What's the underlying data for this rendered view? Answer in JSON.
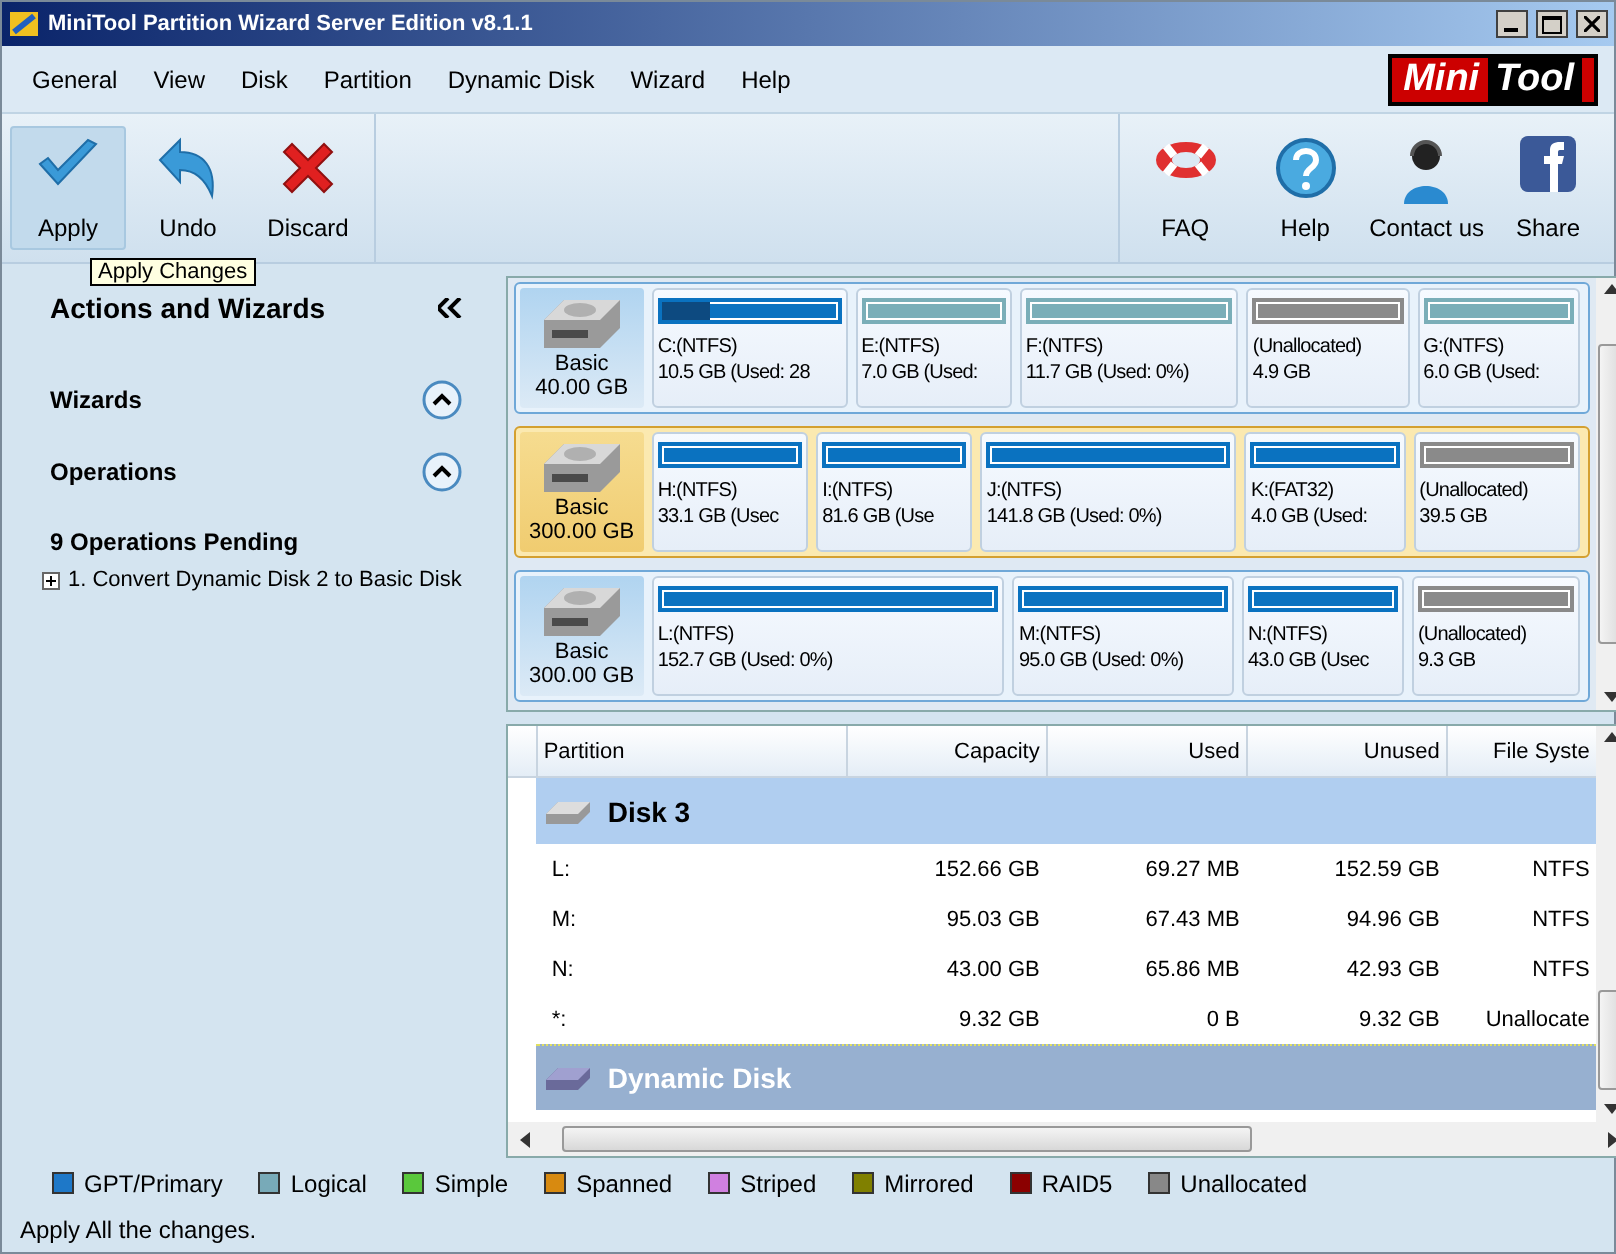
{
  "window": {
    "title": "MiniTool Partition Wizard Server Edition v8.1.1"
  },
  "menu": [
    {
      "label": "General"
    },
    {
      "label": "View"
    },
    {
      "label": "Disk"
    },
    {
      "label": "Partition"
    },
    {
      "label": "Dynamic Disk"
    },
    {
      "label": "Wizard"
    },
    {
      "label": "Help"
    }
  ],
  "logo": {
    "part1": "Mini",
    "part2": "Tool"
  },
  "toolbar": {
    "left": [
      {
        "kind": "apply",
        "label": "Apply",
        "hovered": true
      },
      {
        "kind": "undo",
        "label": "Undo",
        "hovered": false
      },
      {
        "kind": "discard",
        "label": "Discard",
        "hovered": false
      }
    ],
    "right": [
      {
        "kind": "faq",
        "label": "FAQ"
      },
      {
        "kind": "help",
        "label": "Help"
      },
      {
        "kind": "contact",
        "label": "Contact us"
      },
      {
        "kind": "share",
        "label": "Share"
      }
    ]
  },
  "tooltip": "Apply Changes",
  "sidebar": {
    "title": "Actions and Wizards",
    "sections": [
      {
        "label": "Wizards",
        "expanded": true
      },
      {
        "label": "Operations",
        "expanded": true
      }
    ],
    "pending_title": "9 Operations Pending",
    "operations": [
      {
        "label": "1. Convert Dynamic Disk 2 to Basic Disk",
        "expanded": false
      }
    ]
  },
  "disks": [
    {
      "type": "Basic",
      "size": "40.00 GB",
      "selected": false,
      "partitions": [
        {
          "kind": "primary",
          "name": "C:(NTFS)",
          "info": "10.5 GB (Used: 28",
          "level": 0.28
        },
        {
          "kind": "logical",
          "name": "E:(NTFS)",
          "info": "7.0 GB (Used:"
        },
        {
          "kind": "logical",
          "name": "F:(NTFS)",
          "info": "11.7 GB (Used: 0%)"
        },
        {
          "kind": "unallocated",
          "name": "(Unallocated)",
          "info": "4.9 GB"
        },
        {
          "kind": "logical",
          "name": "G:(NTFS)",
          "info": "6.0 GB (Used:"
        }
      ]
    },
    {
      "type": "Basic",
      "size": "300.00 GB",
      "selected": true,
      "partitions": [
        {
          "kind": "primary",
          "name": "H:(NTFS)",
          "info": "33.1 GB (Usec"
        },
        {
          "kind": "primary",
          "name": "I:(NTFS)",
          "info": "81.6 GB (Use"
        },
        {
          "kind": "primary",
          "name": "J:(NTFS)",
          "info": "141.8 GB (Used: 0%)"
        },
        {
          "kind": "primary",
          "name": "K:(FAT32)",
          "info": "4.0 GB (Used:"
        },
        {
          "kind": "unallocated",
          "name": "(Unallocated)",
          "info": "39.5 GB"
        }
      ]
    },
    {
      "type": "Basic",
      "size": "300.00 GB",
      "selected": false,
      "partitions": [
        {
          "kind": "primary",
          "name": "L:(NTFS)",
          "info": "152.7 GB (Used: 0%)"
        },
        {
          "kind": "primary",
          "name": "M:(NTFS)",
          "info": "95.0 GB (Used: 0%)"
        },
        {
          "kind": "primary",
          "name": "N:(NTFS)",
          "info": "43.0 GB (Usec"
        },
        {
          "kind": "unallocated",
          "name": "(Unallocated)",
          "info": "9.3 GB"
        }
      ]
    }
  ],
  "table": {
    "columns": [
      "Partition",
      "Capacity",
      "Used",
      "Unused",
      "File Syste"
    ],
    "rows": [
      {
        "kind": "group",
        "label": "Disk 3",
        "selected": true
      },
      {
        "kind": "row",
        "cells": [
          "L:",
          "152.66 GB",
          "69.27 MB",
          "152.59 GB",
          "NTFS"
        ]
      },
      {
        "kind": "row",
        "cells": [
          "M:",
          "95.03 GB",
          "67.43 MB",
          "94.96 GB",
          "NTFS"
        ]
      },
      {
        "kind": "row",
        "cells": [
          "N:",
          "43.00 GB",
          "65.86 MB",
          "42.93 GB",
          "NTFS"
        ]
      },
      {
        "kind": "row",
        "cells": [
          "*:",
          "9.32 GB",
          "0 B",
          "9.32 GB",
          "Unallocate"
        ]
      },
      {
        "kind": "group",
        "label": "Dynamic Disk",
        "selected": false
      }
    ]
  },
  "legend": [
    {
      "label": "GPT/Primary",
      "color": "#1e78c8"
    },
    {
      "label": "Logical",
      "color": "#78aab8"
    },
    {
      "label": "Simple",
      "color": "#5ac83c"
    },
    {
      "label": "Spanned",
      "color": "#d88a10"
    },
    {
      "label": "Striped",
      "color": "#d080e0"
    },
    {
      "label": "Mirrored",
      "color": "#808000"
    },
    {
      "label": "RAID5",
      "color": "#8b0000"
    },
    {
      "label": "Unallocated",
      "color": "#888888"
    }
  ],
  "status_bar": "Apply All the changes."
}
